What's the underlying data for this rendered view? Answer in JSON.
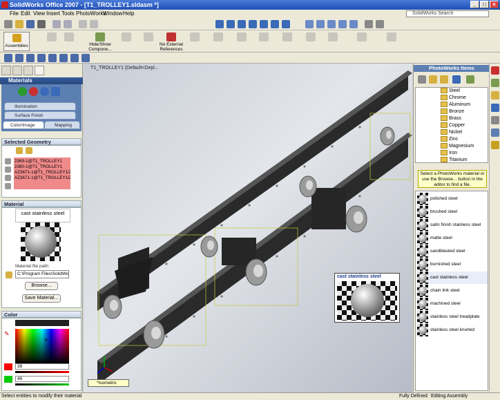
{
  "window": {
    "title": "SolidWorks Office 2007 - [T1_TROLLEY1.sldasm *]"
  },
  "menu": [
    "File",
    "Edit",
    "View",
    "Insert",
    "Tools",
    "PhotoWorks",
    "Window",
    "Help"
  ],
  "search": {
    "placeholder": "SolidWorks Search"
  },
  "toolbar": {
    "assemblies": "Assemblies",
    "items": [
      "Hide/Show Compone...",
      "No External References"
    ]
  },
  "viewport": {
    "title": "T1_TROLLEY1 (Default<Depl..."
  },
  "left": {
    "header": "Materials",
    "tabs": [
      "Illumination",
      "Surface Finish",
      "Color/Image",
      "Mapping"
    ],
    "selected_geometry_title": "Selected Geometry",
    "geometry": [
      "2369-1@T1_TROLLEY1",
      "2380-1@T1_TROLLEY1",
      "AZ3671-1@T1_TROLLEY1/Z2",
      "AZ3671-1@T1_TROLLEY1/Z"
    ],
    "material_title": "Material",
    "material_name": "cast stainless steel",
    "material_path_label": "Material file path:",
    "material_path": "C:\\Program Files\\SolidWork",
    "browse": "Browse...",
    "save": "Save Material...",
    "color_title": "Color",
    "slider1": "38",
    "slider2": "46"
  },
  "right": {
    "header": "PhotoWorks Items",
    "tree": [
      "Steel",
      "Chrome",
      "Aluminum",
      "Bronze",
      "Brass",
      "Copper",
      "Nickel",
      "Zinc",
      "Magnesium",
      "Iron",
      "Titanium"
    ],
    "hint": "Select a PhotoWorks material or use the Browse... button in the editor to find a file.",
    "swatches": [
      "polished steel",
      "brushed steel",
      "satin finish stainless steel",
      "matte steel",
      "sandblasted steel",
      "burnished steel",
      "cast stainless steel",
      "chain link steel",
      "machined steel",
      "stainless steel treadplate",
      "stainless steel knurled"
    ]
  },
  "tooltip": {
    "title": "cast stainless steel"
  },
  "view_selector": "*Isometric",
  "status": {
    "left": "Select entities to modify their material",
    "defined": "Fully Defined",
    "mode": "Editing Assembly"
  },
  "colors": {
    "accent": "#5c7fb2",
    "selection": "#f08a8a",
    "hint_bg": "#ffffc8"
  }
}
